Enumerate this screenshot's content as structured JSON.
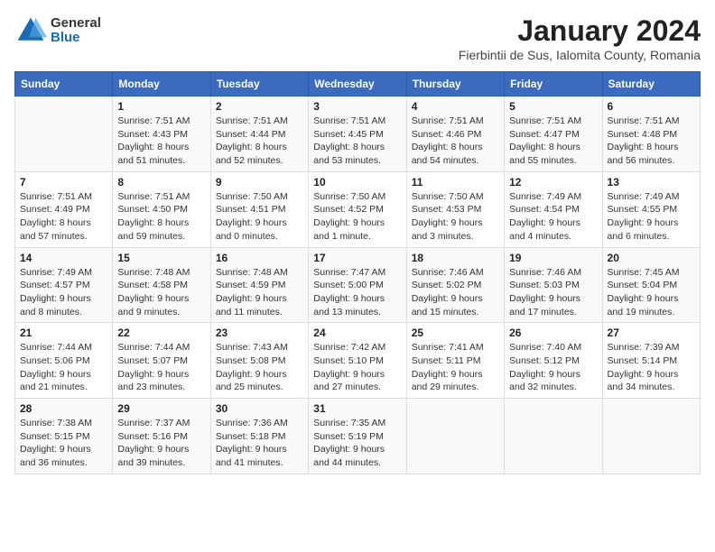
{
  "header": {
    "logo_general": "General",
    "logo_blue": "Blue",
    "title": "January 2024",
    "subtitle": "Fierbintii de Sus, Ialomita County, Romania"
  },
  "weekdays": [
    "Sunday",
    "Monday",
    "Tuesday",
    "Wednesday",
    "Thursday",
    "Friday",
    "Saturday"
  ],
  "weeks": [
    [
      {
        "day": "",
        "sunrise": "",
        "sunset": "",
        "daylight": ""
      },
      {
        "day": "1",
        "sunrise": "Sunrise: 7:51 AM",
        "sunset": "Sunset: 4:43 PM",
        "daylight": "Daylight: 8 hours and 51 minutes."
      },
      {
        "day": "2",
        "sunrise": "Sunrise: 7:51 AM",
        "sunset": "Sunset: 4:44 PM",
        "daylight": "Daylight: 8 hours and 52 minutes."
      },
      {
        "day": "3",
        "sunrise": "Sunrise: 7:51 AM",
        "sunset": "Sunset: 4:45 PM",
        "daylight": "Daylight: 8 hours and 53 minutes."
      },
      {
        "day": "4",
        "sunrise": "Sunrise: 7:51 AM",
        "sunset": "Sunset: 4:46 PM",
        "daylight": "Daylight: 8 hours and 54 minutes."
      },
      {
        "day": "5",
        "sunrise": "Sunrise: 7:51 AM",
        "sunset": "Sunset: 4:47 PM",
        "daylight": "Daylight: 8 hours and 55 minutes."
      },
      {
        "day": "6",
        "sunrise": "Sunrise: 7:51 AM",
        "sunset": "Sunset: 4:48 PM",
        "daylight": "Daylight: 8 hours and 56 minutes."
      }
    ],
    [
      {
        "day": "7",
        "sunrise": "Sunrise: 7:51 AM",
        "sunset": "Sunset: 4:49 PM",
        "daylight": "Daylight: 8 hours and 57 minutes."
      },
      {
        "day": "8",
        "sunrise": "Sunrise: 7:51 AM",
        "sunset": "Sunset: 4:50 PM",
        "daylight": "Daylight: 8 hours and 59 minutes."
      },
      {
        "day": "9",
        "sunrise": "Sunrise: 7:50 AM",
        "sunset": "Sunset: 4:51 PM",
        "daylight": "Daylight: 9 hours and 0 minutes."
      },
      {
        "day": "10",
        "sunrise": "Sunrise: 7:50 AM",
        "sunset": "Sunset: 4:52 PM",
        "daylight": "Daylight: 9 hours and 1 minute."
      },
      {
        "day": "11",
        "sunrise": "Sunrise: 7:50 AM",
        "sunset": "Sunset: 4:53 PM",
        "daylight": "Daylight: 9 hours and 3 minutes."
      },
      {
        "day": "12",
        "sunrise": "Sunrise: 7:49 AM",
        "sunset": "Sunset: 4:54 PM",
        "daylight": "Daylight: 9 hours and 4 minutes."
      },
      {
        "day": "13",
        "sunrise": "Sunrise: 7:49 AM",
        "sunset": "Sunset: 4:55 PM",
        "daylight": "Daylight: 9 hours and 6 minutes."
      }
    ],
    [
      {
        "day": "14",
        "sunrise": "Sunrise: 7:49 AM",
        "sunset": "Sunset: 4:57 PM",
        "daylight": "Daylight: 9 hours and 8 minutes."
      },
      {
        "day": "15",
        "sunrise": "Sunrise: 7:48 AM",
        "sunset": "Sunset: 4:58 PM",
        "daylight": "Daylight: 9 hours and 9 minutes."
      },
      {
        "day": "16",
        "sunrise": "Sunrise: 7:48 AM",
        "sunset": "Sunset: 4:59 PM",
        "daylight": "Daylight: 9 hours and 11 minutes."
      },
      {
        "day": "17",
        "sunrise": "Sunrise: 7:47 AM",
        "sunset": "Sunset: 5:00 PM",
        "daylight": "Daylight: 9 hours and 13 minutes."
      },
      {
        "day": "18",
        "sunrise": "Sunrise: 7:46 AM",
        "sunset": "Sunset: 5:02 PM",
        "daylight": "Daylight: 9 hours and 15 minutes."
      },
      {
        "day": "19",
        "sunrise": "Sunrise: 7:46 AM",
        "sunset": "Sunset: 5:03 PM",
        "daylight": "Daylight: 9 hours and 17 minutes."
      },
      {
        "day": "20",
        "sunrise": "Sunrise: 7:45 AM",
        "sunset": "Sunset: 5:04 PM",
        "daylight": "Daylight: 9 hours and 19 minutes."
      }
    ],
    [
      {
        "day": "21",
        "sunrise": "Sunrise: 7:44 AM",
        "sunset": "Sunset: 5:06 PM",
        "daylight": "Daylight: 9 hours and 21 minutes."
      },
      {
        "day": "22",
        "sunrise": "Sunrise: 7:44 AM",
        "sunset": "Sunset: 5:07 PM",
        "daylight": "Daylight: 9 hours and 23 minutes."
      },
      {
        "day": "23",
        "sunrise": "Sunrise: 7:43 AM",
        "sunset": "Sunset: 5:08 PM",
        "daylight": "Daylight: 9 hours and 25 minutes."
      },
      {
        "day": "24",
        "sunrise": "Sunrise: 7:42 AM",
        "sunset": "Sunset: 5:10 PM",
        "daylight": "Daylight: 9 hours and 27 minutes."
      },
      {
        "day": "25",
        "sunrise": "Sunrise: 7:41 AM",
        "sunset": "Sunset: 5:11 PM",
        "daylight": "Daylight: 9 hours and 29 minutes."
      },
      {
        "day": "26",
        "sunrise": "Sunrise: 7:40 AM",
        "sunset": "Sunset: 5:12 PM",
        "daylight": "Daylight: 9 hours and 32 minutes."
      },
      {
        "day": "27",
        "sunrise": "Sunrise: 7:39 AM",
        "sunset": "Sunset: 5:14 PM",
        "daylight": "Daylight: 9 hours and 34 minutes."
      }
    ],
    [
      {
        "day": "28",
        "sunrise": "Sunrise: 7:38 AM",
        "sunset": "Sunset: 5:15 PM",
        "daylight": "Daylight: 9 hours and 36 minutes."
      },
      {
        "day": "29",
        "sunrise": "Sunrise: 7:37 AM",
        "sunset": "Sunset: 5:16 PM",
        "daylight": "Daylight: 9 hours and 39 minutes."
      },
      {
        "day": "30",
        "sunrise": "Sunrise: 7:36 AM",
        "sunset": "Sunset: 5:18 PM",
        "daylight": "Daylight: 9 hours and 41 minutes."
      },
      {
        "day": "31",
        "sunrise": "Sunrise: 7:35 AM",
        "sunset": "Sunset: 5:19 PM",
        "daylight": "Daylight: 9 hours and 44 minutes."
      },
      {
        "day": "",
        "sunrise": "",
        "sunset": "",
        "daylight": ""
      },
      {
        "day": "",
        "sunrise": "",
        "sunset": "",
        "daylight": ""
      },
      {
        "day": "",
        "sunrise": "",
        "sunset": "",
        "daylight": ""
      }
    ]
  ]
}
